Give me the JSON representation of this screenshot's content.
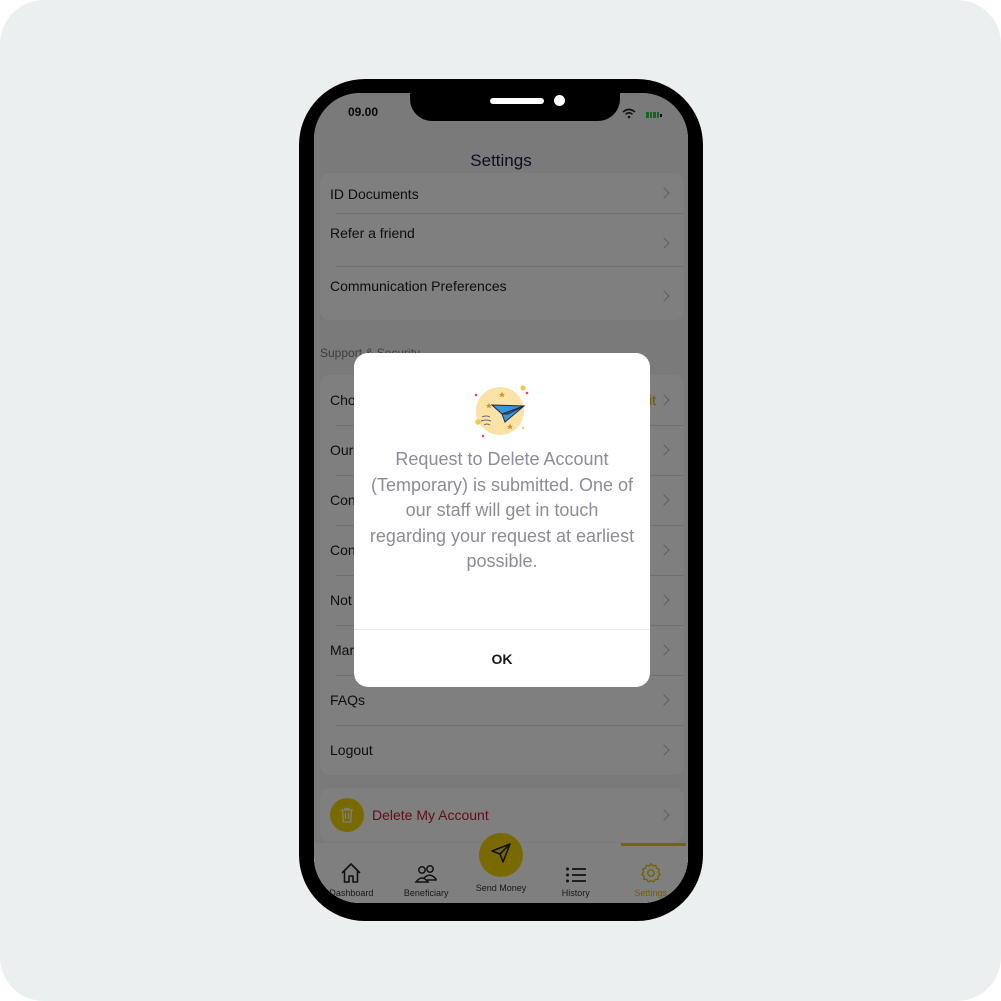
{
  "status_bar": {
    "time": "09.00"
  },
  "header": {
    "title": "Settings"
  },
  "account_items": [
    {
      "label": "ID Documents"
    },
    {
      "label": "Refer a friend"
    },
    {
      "label": "Communication Preferences"
    }
  ],
  "support_section": {
    "label": "Support & Security",
    "items": [
      {
        "label": "Cho"
      },
      {
        "label": "Our"
      },
      {
        "label": "Con"
      },
      {
        "label": "Con"
      },
      {
        "label": "Not"
      },
      {
        "label": "Mar"
      },
      {
        "label": "FAQs"
      },
      {
        "label": "Logout"
      }
    ],
    "first_item_trailing": "it"
  },
  "delete_account": {
    "label": "Delete My Account"
  },
  "tabbar": {
    "tabs": [
      {
        "label": "Dashboard",
        "icon": "home-icon"
      },
      {
        "label": "Beneficiary",
        "icon": "users-icon"
      },
      {
        "label": "Send Money",
        "icon": "send-icon"
      },
      {
        "label": "History",
        "icon": "list-icon"
      },
      {
        "label": "Settings",
        "icon": "gear-icon",
        "active": true
      }
    ]
  },
  "modal": {
    "message": "Request to Delete Account (Temporary) is submitted. One of our staff will get in touch regarding your request at earliest possible.",
    "ok_label": "OK"
  },
  "colors": {
    "accent": "#f2d400",
    "danger": "#c51a3a",
    "modal_text": "#8e8a9a"
  }
}
